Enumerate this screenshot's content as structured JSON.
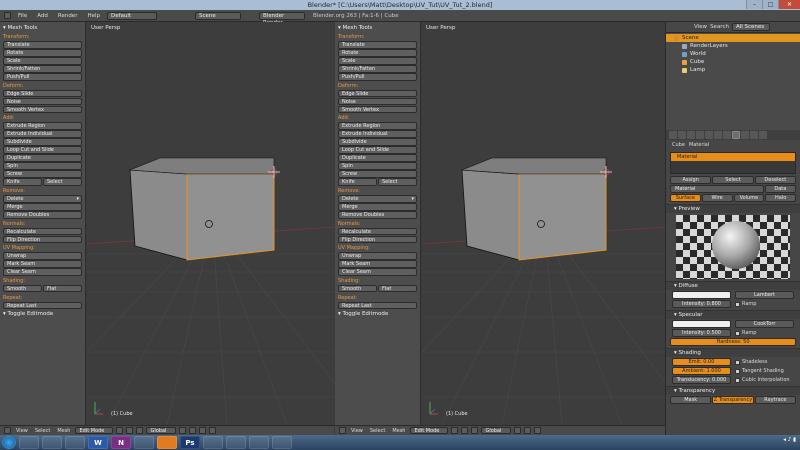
{
  "window": {
    "title": "Blender* [C:\\Users\\Matt\\Desktop\\UV_Tut\\UV_Tut_2.blend]",
    "minimize": "–",
    "maximize": "□",
    "close": "✕"
  },
  "info_header": {
    "menus": [
      "File",
      "Add",
      "Render",
      "Help"
    ],
    "screen_layout": "Default",
    "scene": "Scene",
    "render_engine": "Blender Render",
    "stats": "Blender.org 263 | Fa:1-6 | Cube"
  },
  "tool_shelf": {
    "title": "Mesh Tools",
    "sections": [
      {
        "title": "Transform:",
        "buttons": [
          "Translate",
          "Rotate",
          "Scale",
          "Shrink/Fatten",
          "Push/Pull"
        ]
      },
      {
        "title": "Deform:",
        "buttons": [
          "Edge Slide",
          "Noise",
          "Smooth Vertex"
        ]
      },
      {
        "title": "Add:",
        "buttons": [
          "Extrude Region",
          "Extrude Individual",
          "Subdivide",
          "Loop Cut and Slide",
          "Duplicate",
          "Spin",
          "Screw"
        ],
        "pair": [
          "Knife",
          "Select"
        ]
      },
      {
        "title": "Remove:",
        "dropdown": "Delete",
        "buttons": [
          "Merge",
          "Remove Doubles"
        ]
      },
      {
        "title": "Normals:",
        "buttons": [
          "Recalculate",
          "Flip Direction"
        ]
      },
      {
        "title": "UV Mapping:",
        "buttons": [
          "Unwrap",
          "Mark Seam",
          "Clear Seam"
        ]
      },
      {
        "title": "Shading:",
        "pair": [
          "Smooth",
          "Flat"
        ]
      },
      {
        "title": "Repeat:",
        "buttons": [
          "Repeat Last"
        ]
      }
    ],
    "footer": "Toggle Editmode"
  },
  "viewport": {
    "label": "User Persp",
    "object_label": "(1) Cube"
  },
  "view_header": {
    "menus": [
      "View",
      "Select",
      "Mesh"
    ],
    "mode": "Edit Mode",
    "orientation": "Global"
  },
  "outliner": {
    "menus": [
      "View",
      "Search"
    ],
    "filter": "All Scenes",
    "items": [
      {
        "label": "Scene",
        "color": "#d88a2c"
      },
      {
        "label": "RenderLayers",
        "color": "#9aa9c2"
      },
      {
        "label": "World",
        "color": "#6ea0c8"
      },
      {
        "label": "Cube",
        "color": "#e8a040"
      },
      {
        "label": "Lamp",
        "color": "#e8d070"
      }
    ]
  },
  "properties": {
    "breadcrumb": [
      "Cube",
      "Material"
    ],
    "slot_item": "Material",
    "slot_buttons": [
      "Assign",
      "Select",
      "Deselect"
    ],
    "material_name": "Material",
    "data_link": "Data",
    "type_tabs": [
      "Surface",
      "Wire",
      "Volume",
      "Halo"
    ],
    "preview_title": "Preview",
    "diffuse": {
      "title": "Diffuse",
      "shader": "Lambert",
      "intensity": "Intensity: 0.800",
      "ramp": "Ramp"
    },
    "specular": {
      "title": "Specular",
      "shader": "CookTorr",
      "intensity": "Intensity: 0.500",
      "ramp": "Ramp",
      "hardness": "Hardness: 50"
    },
    "shading": {
      "title": "Shading",
      "emit": "Emit: 0.00",
      "ambient": "Ambient: 1.000",
      "translucency": "Translucency: 0.000",
      "shadeless": "Shadeless",
      "tangent": "Tangent Shading",
      "cubic": "Cubic Interpolation"
    },
    "transparency": {
      "title": "Transparency",
      "tabs": [
        "Mask",
        "Z Transparency",
        "Raytrace"
      ]
    }
  },
  "taskbar": {
    "apps": [
      "",
      "",
      "",
      "W",
      "N",
      "",
      "",
      "Ps",
      "",
      "",
      "",
      ""
    ],
    "tray": "◂ ♪ ▮"
  }
}
